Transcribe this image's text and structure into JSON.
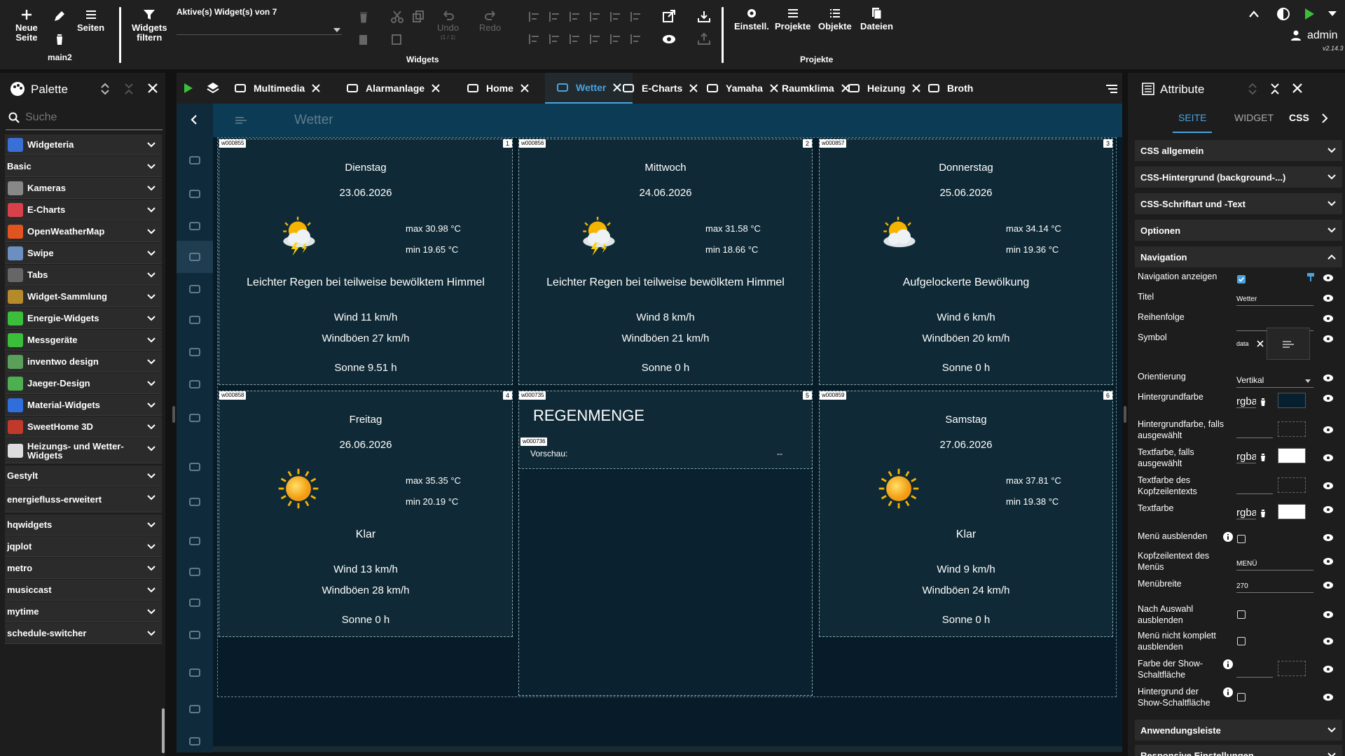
{
  "toolbar": {
    "new_page": "Neue\nSeite",
    "pages": "Seiten",
    "project_name": "main2",
    "widgets_filter": "Widgets\nfiltern",
    "active_widgets": "Aktive(s) Widget(s) von 7",
    "undo": "Undo",
    "undo_count": "(1 / 1)",
    "redo": "Redo",
    "group_widgets": "Widgets",
    "settings": "Einstell.",
    "projects": "Projekte",
    "objects": "Objekte",
    "files": "Dateien",
    "group_projects": "Projekte",
    "user": "admin",
    "version": "v2.14.3"
  },
  "palette": {
    "title": "Palette",
    "search_placeholder": "Suche",
    "items": [
      {
        "label": "Widgeteria",
        "icon": "widgeteria-icon",
        "color": "#3a6fd8"
      },
      {
        "label": "Basic",
        "icon": "",
        "color": ""
      },
      {
        "label": "Kameras",
        "icon": "camera-icon",
        "color": "#888888"
      },
      {
        "label": "E-Charts",
        "icon": "echarts-icon",
        "color": "#d8404a"
      },
      {
        "label": "OpenWeatherMap",
        "icon": "owm-icon",
        "color": "#e2541f"
      },
      {
        "label": "Swipe",
        "icon": "swipe-icon",
        "color": "#6a8fc0"
      },
      {
        "label": "Tabs",
        "icon": "tabs-icon",
        "color": "#666666"
      },
      {
        "label": "Widget-Sammlung",
        "icon": "collection-icon",
        "color": "#b58a2a"
      },
      {
        "label": "Energie-Widgets",
        "icon": "energy-icon",
        "color": "#3bbf3b"
      },
      {
        "label": "Messgeräte",
        "icon": "gauge-icon",
        "color": "#3bbf3b"
      },
      {
        "label": "inventwo design",
        "icon": "inventwo-icon",
        "color": "#5aa05a"
      },
      {
        "label": "Jaeger-Design",
        "icon": "jaeger-icon",
        "color": "#4caf50"
      },
      {
        "label": "Material-Widgets",
        "icon": "material-icon",
        "color": "#2f6fdc"
      },
      {
        "label": "SweetHome 3D",
        "icon": "sweethome-icon",
        "color": "#c0392b"
      },
      {
        "label": "Heizungs- und Wetter-Widgets",
        "icon": "heating-icon",
        "color": "#dddddd"
      },
      {
        "label": "Gestylt",
        "icon": "",
        "color": ""
      },
      {
        "label": "energiefluss-erweitert",
        "icon": "",
        "color": ""
      },
      {
        "label": "hqwidgets",
        "icon": "",
        "color": ""
      },
      {
        "label": "jqplot",
        "icon": "",
        "color": ""
      },
      {
        "label": "metro",
        "icon": "",
        "color": ""
      },
      {
        "label": "musiccast",
        "icon": "",
        "color": ""
      },
      {
        "label": "mytime",
        "icon": "",
        "color": ""
      },
      {
        "label": "schedule-switcher",
        "icon": "",
        "color": ""
      }
    ]
  },
  "tabs": [
    {
      "label": "Multimedia",
      "icon": "music-icon",
      "active": false
    },
    {
      "label": "Alarmanlage",
      "icon": "alarm-icon",
      "active": false
    },
    {
      "label": "Home",
      "icon": "home-icon",
      "active": false
    },
    {
      "label": "Wetter",
      "icon": "weather-icon",
      "active": true
    },
    {
      "label": "E-Charts",
      "icon": "chart-icon",
      "active": false
    },
    {
      "label": "Yamaha",
      "icon": "receiver-icon",
      "active": false
    },
    {
      "label": "Raumklima",
      "icon": "",
      "active": false
    },
    {
      "label": "Heizung",
      "icon": "radiator-icon",
      "active": false
    },
    {
      "label": "Broth",
      "icon": "printer-icon",
      "active": false
    }
  ],
  "page": {
    "header_title": "Wetter"
  },
  "days": [
    {
      "id": "w000855",
      "num": "1",
      "day": "Dienstag",
      "date": "23.06.2026",
      "max": "max 30.98 °C",
      "min": "min 19.65 °C",
      "desc": "Leichter Regen bei teilweise bewölktem Himmel",
      "wind": "Wind 11 km/h",
      "gust": "Windböen 27 km/h",
      "sun": "Sonne 9.51 h",
      "icon": "storm-icon"
    },
    {
      "id": "w000856",
      "num": "2",
      "day": "Mittwoch",
      "date": "24.06.2026",
      "max": "max 31.58 °C",
      "min": "min 18.66 °C",
      "desc": "Leichter Regen bei teilweise bewölktem Himmel",
      "wind": "Wind 8 km/h",
      "gust": "Windböen 21 km/h",
      "sun": "Sonne 0 h",
      "icon": "storm-icon"
    },
    {
      "id": "w000857",
      "num": "3",
      "day": "Donnerstag",
      "date": "25.06.2026",
      "max": "max 34.14 °C",
      "min": "min 19.36 °C",
      "desc": "Aufgelockerte Bewölkung",
      "wind": "Wind 6 km/h",
      "gust": "Windböen 20 km/h",
      "sun": "Sonne 0 h",
      "icon": "partly-cloudy-icon"
    },
    {
      "id": "w000858",
      "num": "4",
      "day": "Freitag",
      "date": "26.06.2026",
      "max": "max 35.35 °C",
      "min": "min 20.19 °C",
      "desc": "Klar",
      "wind": "Wind 13 km/h",
      "gust": "Windböen 28 km/h",
      "sun": "Sonne 0 h",
      "icon": "sun-icon"
    },
    {
      "id": "w000859",
      "num": "6",
      "day": "Samstag",
      "date": "27.06.2026",
      "max": "max 37.81 °C",
      "min": "min 19.38 °C",
      "desc": "Klar",
      "wind": "Wind 9 km/h",
      "gust": "Windböen 24 km/h",
      "sun": "Sonne 0 h",
      "icon": "sun-icon"
    }
  ],
  "rain": {
    "id": "w000735",
    "num": "5",
    "title": "REGENMENGE",
    "inner_id": "w000736",
    "preview_label": "Vorschau:",
    "preview_value": "--"
  },
  "attributes": {
    "title": "Attribute",
    "tabs": [
      "SEITE",
      "WIDGET",
      "CSS"
    ],
    "sections": [
      "CSS allgemein",
      "CSS-Hintergrund (background-...)",
      "CSS-Schriftart und -Text",
      "Optionen",
      "Navigation"
    ],
    "bottom_sections": [
      "Anwendungsleiste",
      "Responsive Einstellungen"
    ],
    "nav": {
      "show_nav": "Navigation anzeigen",
      "title_label": "Titel",
      "title_value": "Wetter",
      "order_label": "Reihenfolge",
      "symbol_label": "Symbol",
      "symbol_value": "data",
      "orientation_label": "Orientierung",
      "orientation_value": "Vertikal",
      "bg_label": "Hintergrundfarbe",
      "bg_value": "rgba",
      "bg_sel_label": "Hintergrundfarbe, falls ausgewählt",
      "text_sel_label": "Textfarbe, falls ausgewählt",
      "text_sel_value": "rgba",
      "header_color_label": "Textfarbe des Kopfzeilentexts",
      "text_label": "Textfarbe",
      "text_value": "rgba",
      "hide_menu_label": "Menü ausblenden",
      "menu_header_label": "Kopfzeilentext des Menüs",
      "menu_header_value": "MENÜ",
      "menu_width_label": "Menübreite",
      "menu_width_value": "270",
      "hide_after_label": "Nach Auswahl ausblenden",
      "not_hide_label": "Menü nicht komplett ausblenden",
      "show_btn_color_label": "Farbe der Show-Schaltfläche",
      "show_btn_bg_label": "Hintergrund der Show-Schaltfläche"
    }
  },
  "colors": {
    "accent": "#4aa3df",
    "canvas": "#071c28",
    "card": "#0f2a36",
    "header": "#0c3b55"
  }
}
